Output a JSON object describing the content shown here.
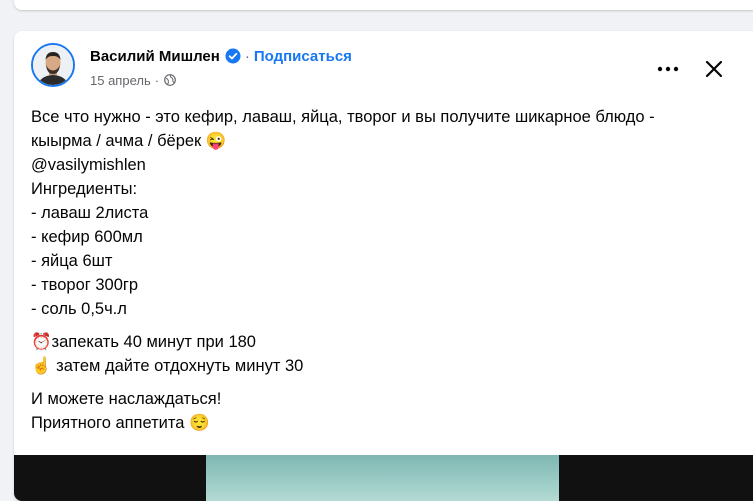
{
  "post": {
    "author": "Василий Мишлен",
    "separator": "·",
    "subscribe_label": "Подписаться",
    "date": "15 апрель",
    "text_lines": [
      "Все что нужно - это кефир, лаваш, яйца, творог и вы получите шикарное блюдо -",
      "кыырма / ачма / бёрек 😜",
      "@vasilymishlen",
      "Ингредиенты:",
      "- лаваш 2листа",
      "- кефир 600мл",
      "- яйца 6шт",
      "- творог 300гр",
      "- соль 0,5ч.л",
      "⏰запекать 40 минут при 180",
      "☝️ затем дайте отдохнуть минут 30",
      "И можете наслаждаться!",
      "Приятного аппетита 😌"
    ]
  },
  "icons": {
    "verified": "verified-badge-icon",
    "globe": "globe-icon",
    "more": "more-dots-icon",
    "close": "close-icon"
  },
  "colors": {
    "accent": "#1877f2",
    "text": "#050505",
    "secondary": "#65676b",
    "background": "#f0f2f5"
  }
}
